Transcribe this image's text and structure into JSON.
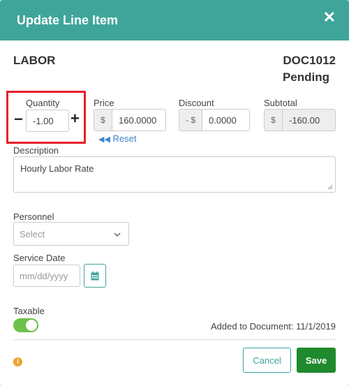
{
  "colors": {
    "header": "#3fa59b",
    "save": "#1f8a2d",
    "toggle_on": "#6cc24a",
    "highlight": "#e8202a",
    "link": "#3a84c9"
  },
  "header": {
    "title": "Update Line Item",
    "close_icon": "close-icon"
  },
  "item": {
    "name": "LABOR",
    "doc_number": "DOC1012",
    "doc_status": "Pending"
  },
  "quantity": {
    "label": "Quantity",
    "value": "-1.00",
    "minus": "−",
    "plus": "+"
  },
  "price": {
    "label": "Price",
    "prefix": "$",
    "value": "160.0000",
    "reset_label": "Reset"
  },
  "discount": {
    "label": "Discount",
    "prefix": "- $",
    "value": "0.0000"
  },
  "subtotal": {
    "label": "Subtotal",
    "prefix": "$",
    "value": "-160.00"
  },
  "description": {
    "label": "Description",
    "value": "Hourly Labor Rate"
  },
  "personnel": {
    "label": "Personnel",
    "placeholder": "Select"
  },
  "service_date": {
    "label": "Service Date",
    "placeholder": "mm/dd/yyyy"
  },
  "taxable": {
    "label": "Taxable",
    "enabled": true
  },
  "footer": {
    "added_text": "Added to Document: 11/1/2019",
    "info_icon": "i",
    "cancel_label": "Cancel",
    "save_label": "Save"
  }
}
